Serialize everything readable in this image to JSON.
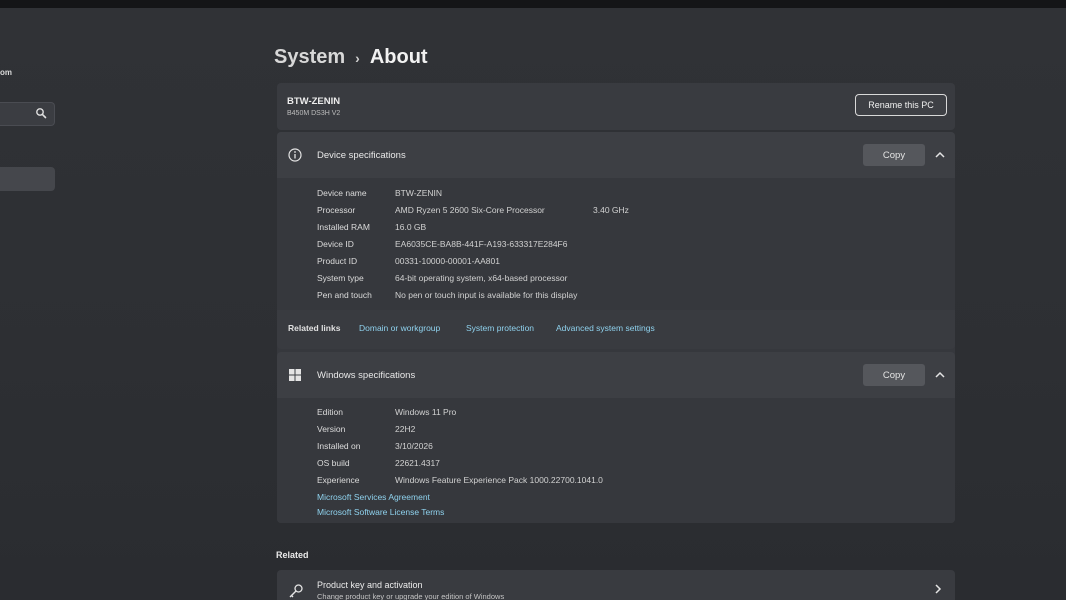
{
  "sidebar": {
    "account_fragment": "om"
  },
  "breadcrumb": {
    "parent": "System",
    "separator": "›",
    "current": "About"
  },
  "pc": {
    "name": "BTW-ZENIN",
    "model": "B450M DS3H V2",
    "rename_label": "Rename this PC"
  },
  "device_specs": {
    "title": "Device specifications",
    "copy_label": "Copy",
    "rows": [
      {
        "label": "Device name",
        "value": "BTW-ZENIN"
      },
      {
        "label": "Processor",
        "value": "AMD Ryzen 5 2600 Six-Core Processor",
        "extra": "3.40 GHz"
      },
      {
        "label": "Installed RAM",
        "value": "16.0 GB"
      },
      {
        "label": "Device ID",
        "value": "EA6035CE-BA8B-441F-A193-633317E284F6"
      },
      {
        "label": "Product ID",
        "value": "00331-10000-00001-AA801"
      },
      {
        "label": "System type",
        "value": "64-bit operating system, x64-based processor"
      },
      {
        "label": "Pen and touch",
        "value": "No pen or touch input is available for this display"
      }
    ]
  },
  "related_links": {
    "label": "Related links",
    "links": [
      "Domain or workgroup",
      "System protection",
      "Advanced system settings"
    ]
  },
  "windows_specs": {
    "title": "Windows specifications",
    "copy_label": "Copy",
    "rows": [
      {
        "label": "Edition",
        "value": "Windows 11 Pro"
      },
      {
        "label": "Version",
        "value": "22H2"
      },
      {
        "label": "Installed on",
        "value": "3/10/2026"
      },
      {
        "label": "OS build",
        "value": "22621.4317"
      },
      {
        "label": "Experience",
        "value": "Windows Feature Experience Pack 1000.22700.1041.0"
      }
    ],
    "links": [
      "Microsoft Services Agreement",
      "Microsoft Software License Terms"
    ]
  },
  "related": {
    "heading": "Related",
    "product_key": {
      "title": "Product key and activation",
      "subtitle": "Change product key or upgrade your edition of Windows"
    }
  },
  "colors": {
    "link": "#8fd2ee",
    "card": "#393b40",
    "background": "#2d2f33"
  }
}
